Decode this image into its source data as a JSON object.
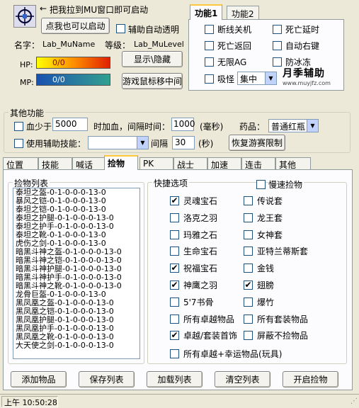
{
  "header": {
    "drag_hint": "把我拉到MU窗口即可启动",
    "start_button": "点我也可以启动",
    "auto_transparent": "辅助自动透明",
    "name_label": "名字：",
    "name_value": "Lab_MuName",
    "level_label": "等级：",
    "level_value": "Lab_MuLevel",
    "show_hide_button": "显示\\隐藏",
    "hp_label": "HP:",
    "hp_value": "0/0",
    "mp_label": "MP:",
    "mp_value": "0/0",
    "mouse_center_button": "游戏鼠标移中间"
  },
  "func_tabs": [
    "功能1",
    "功能2"
  ],
  "func": {
    "disconnect_shutdown": "断线关机",
    "death_delay": "死亡延时",
    "death_return": "死亡返回",
    "auto_right_key": "自动右键",
    "no_ag": "无限AG",
    "anti_ice": "防冰冻",
    "absorb_monster": "吸怪",
    "absorb_select": "集中",
    "logo_text": "月季辅助",
    "logo_url": "www.muyjfz.com"
  },
  "other": {
    "title": "其他功能",
    "hp_less_than": "血少于",
    "hp_value": "5000",
    "interval_text": "时加血，间隔时间：",
    "interval_value": "1000",
    "ms_unit": "(毫秒)",
    "potion_label": "药品：",
    "potion_value": "普通红瓶",
    "use_skill": "使用辅助技能：",
    "skill_value": "",
    "gap_label": "间隔",
    "gap_value": "30",
    "sec_unit": "(秒)",
    "restore_button": "恢复游赛限制"
  },
  "tabs": [
    "位置",
    "技能",
    "喊话",
    "捡物",
    "PK",
    "战士",
    "加速",
    "连击",
    "其他"
  ],
  "pickup": {
    "list_title": "捡物列表",
    "items": [
      "泰坦之盔-0-1-0-0-0-13-0",
      "暴风之铠-0-1-0-0-0-13-0",
      "泰坦之铠-0-1-0-0-0-13-0",
      "泰坦之护腿-0-1-0-0-0-13-0",
      "泰坦之护手-0-1-0-0-0-13-0",
      "泰坦之靴-0-1-0-0-0-13-0",
      "虎伤之剑-0-1-0-0-0-13-0",
      "暗黑斗神之盔-0-1-0-0-0-13-0",
      "暗黑斗神之铠-0-1-0-0-0-13-0",
      "暗黑斗神护腿-0-1-0-0-0-13-0",
      "暗黑斗神护手-0-1-0-0-0-13-0",
      "暗黑斗神之靴-0-1-0-0-0-13-0",
      "龙骨巨盔-0-1-0-0-0-13-0",
      "黑凤凰之盔-0-1-0-0-0-13-0",
      "黑凤凰之铠-0-1-0-0-0-13-0",
      "黑凤凰护腿-0-1-0-0-0-13-0",
      "黑凤凰护手-0-1-0-0-0-13-0",
      "黑凤凰之靴-0-1-0-0-0-13-0",
      "大天使之剑-0-1-0-0-0-13-0"
    ],
    "quick_title": "快捷选项",
    "slow_pickup": "慢速捡物",
    "options_left": [
      {
        "label": "灵魂宝石",
        "checked": "✔"
      },
      {
        "label": "洛克之羽",
        "checked": ""
      },
      {
        "label": "玛雅之石",
        "checked": ""
      },
      {
        "label": "生命宝石",
        "checked": ""
      },
      {
        "label": "祝福宝石",
        "checked": "✔"
      },
      {
        "label": "神鹰之羽",
        "checked": "✔"
      },
      {
        "label": "5'7书骨",
        "checked": ""
      },
      {
        "label": "所有卓越物品",
        "checked": ""
      },
      {
        "label": "卓越/套装首饰",
        "checked": "✔"
      }
    ],
    "options_right": [
      {
        "label": "传说套",
        "checked": ""
      },
      {
        "label": "龙王套",
        "checked": ""
      },
      {
        "label": "女神套",
        "checked": ""
      },
      {
        "label": "亚特兰蒂斯套",
        "checked": ""
      },
      {
        "label": "金钱",
        "checked": ""
      },
      {
        "label": "翅膀",
        "checked": "✔"
      },
      {
        "label": "爆竹",
        "checked": ""
      },
      {
        "label": "所有套装物品",
        "checked": ""
      },
      {
        "label": "屏蔽不捡物品",
        "checked": ""
      }
    ],
    "option_bottom": "所有卓越+幸运物品(玩具)"
  },
  "buttons": [
    "添加物品",
    "保存列表",
    "加载列表",
    "清空列表",
    "开启捡物"
  ],
  "status": {
    "time": "上午 10:50:28"
  },
  "colors": {
    "hp_start": "#ffff00",
    "hp_end": "#e02000",
    "mp_start": "#2060c0",
    "mp_end": "#30a090"
  }
}
